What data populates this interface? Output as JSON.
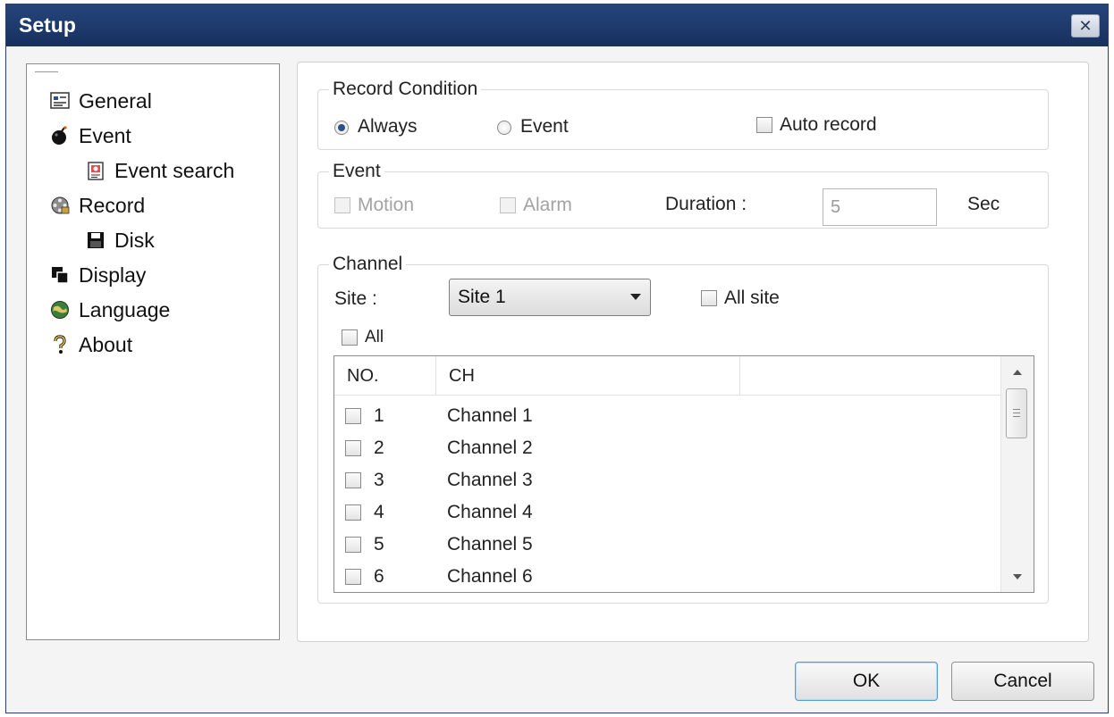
{
  "window": {
    "title": "Setup",
    "close_glyph": "✕"
  },
  "tree": {
    "items": [
      {
        "label": "General",
        "icon": "general-settings-icon"
      },
      {
        "label": "Event",
        "icon": "bomb-icon"
      },
      {
        "label": "Event search",
        "icon": "event-search-icon"
      },
      {
        "label": "Record",
        "icon": "film-reel-icon"
      },
      {
        "label": "Disk",
        "icon": "floppy-disk-icon"
      },
      {
        "label": "Display",
        "icon": "display-windows-icon"
      },
      {
        "label": "Language",
        "icon": "globe-icon"
      },
      {
        "label": "About",
        "icon": "question-mark-icon"
      }
    ]
  },
  "record_condition": {
    "title": "Record Condition",
    "always_label": "Always",
    "event_label": "Event",
    "auto_record_label": "Auto record",
    "selected": "Always"
  },
  "event": {
    "title": "Event",
    "motion_label": "Motion",
    "alarm_label": "Alarm",
    "duration_label": "Duration :",
    "duration_value": "5",
    "unit_label": "Sec"
  },
  "channel": {
    "title": "Channel",
    "site_label": "Site :",
    "site_selected": "Site 1",
    "all_site_label": "All site",
    "all_label": "All",
    "columns": [
      "NO.",
      "CH",
      ""
    ],
    "rows": [
      {
        "no": "1",
        "ch": "Channel 1"
      },
      {
        "no": "2",
        "ch": "Channel 2"
      },
      {
        "no": "3",
        "ch": "Channel 3"
      },
      {
        "no": "4",
        "ch": "Channel 4"
      },
      {
        "no": "5",
        "ch": "Channel 5"
      },
      {
        "no": "6",
        "ch": "Channel 6"
      }
    ]
  },
  "buttons": {
    "ok": "OK",
    "cancel": "Cancel"
  },
  "colors": {
    "titlebar": "#1f3a6b",
    "accent": "#2c4f86"
  }
}
